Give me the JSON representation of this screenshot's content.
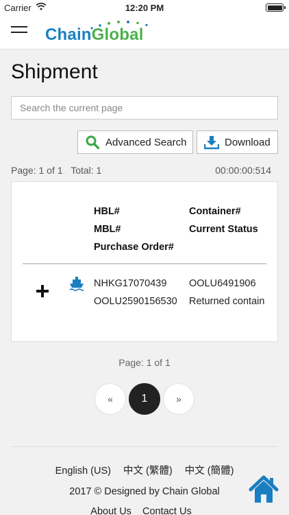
{
  "status_bar": {
    "carrier": "Carrier",
    "time": "12:20 PM"
  },
  "app": {
    "logo": {
      "part1": "Chain",
      "part2": "Gl",
      "part3": "o",
      "part4": "bal"
    }
  },
  "page": {
    "title": "Shipment"
  },
  "search": {
    "placeholder": "Search the current page"
  },
  "toolbar": {
    "advanced_search": "Advanced Search",
    "download": "Download"
  },
  "results": {
    "page_info": "Page: 1 of 1",
    "total": "Total: 1",
    "elapsed": "00:00:00:514"
  },
  "table": {
    "headers": {
      "hbl": "HBL#",
      "container": "Container#",
      "mbl": "MBL#",
      "status": "Current Status",
      "po": "Purchase Order#"
    },
    "rows": [
      {
        "hbl": "NHKG17070439",
        "container": "OOLU6491906",
        "mbl": "OOLU2590156530",
        "status": "Returned contain",
        "po": ""
      }
    ]
  },
  "pagination": {
    "label": "Page: 1 of 1",
    "prev": "«",
    "current": "1",
    "next": "»"
  },
  "footer": {
    "languages": [
      "English (US)",
      "中文 (繁體)",
      "中文 (簡體)"
    ],
    "copyright": "2017 © Designed by Chain Global",
    "links": [
      "About Us",
      "Contact Us"
    ]
  },
  "colors": {
    "brand_blue": "#1a7fc0",
    "brand_green": "#4bb04b",
    "search_icon": "#3aa845",
    "download_icon": "#1a7fc0",
    "home_icon": "#1a7fc0"
  },
  "icons": [
    "wifi-icon",
    "battery-icon",
    "menu-icon",
    "search-icon",
    "download-icon",
    "expand-icon",
    "ship-icon",
    "home-icon"
  ]
}
